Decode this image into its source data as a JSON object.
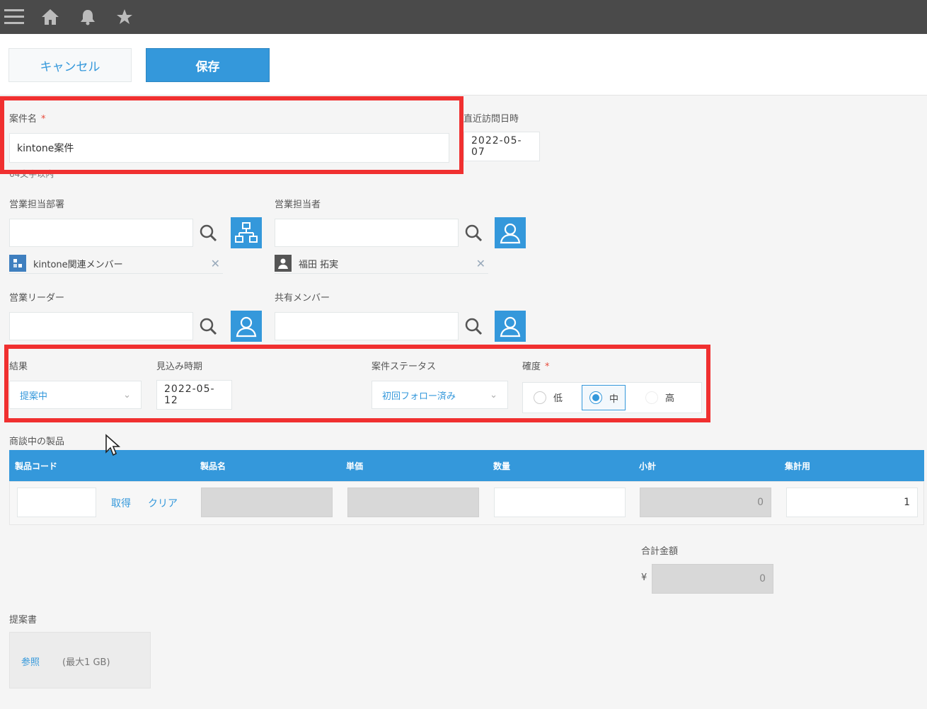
{
  "actions": {
    "cancel_label": "キャンセル",
    "save_label": "保存"
  },
  "fields": {
    "project_name": {
      "label": "案件名",
      "required": "*",
      "value": "kintone案件",
      "hint": "64文字以内"
    },
    "last_visit": {
      "label": "直近訪問日時",
      "value": "2022-05-07"
    },
    "sales_dept": {
      "label": "営業担当部署",
      "selected": "kintone関連メンバー"
    },
    "sales_rep": {
      "label": "営業担当者",
      "selected": "福田 拓実"
    },
    "sales_leader": {
      "label": "営業リーダー"
    },
    "shared_members": {
      "label": "共有メンバー"
    },
    "result": {
      "label": "結果",
      "value": "提案中"
    },
    "expected_date": {
      "label": "見込み時期",
      "value": "2022-05-12"
    },
    "status": {
      "label": "案件ステータス",
      "value": "初回フォロー済み"
    },
    "certainty": {
      "label": "確度",
      "required": "*",
      "options": [
        "低",
        "中",
        "高"
      ],
      "selected": "中"
    }
  },
  "products": {
    "label": "商談中の製品",
    "columns": [
      "製品コード",
      "製品名",
      "単価",
      "数量",
      "小計",
      "集計用"
    ],
    "fetch_label": "取得",
    "clear_label": "クリア",
    "subtotal": "0",
    "agg": "1"
  },
  "total": {
    "label": "合計金額",
    "currency": "¥",
    "value": "0"
  },
  "proposal": {
    "label": "提案書",
    "browse_label": "参照",
    "limit": "(最大1 GB)"
  },
  "colors": {
    "accent": "#3498db",
    "topbar": "#4a4a4a",
    "highlight": "#f03030"
  }
}
